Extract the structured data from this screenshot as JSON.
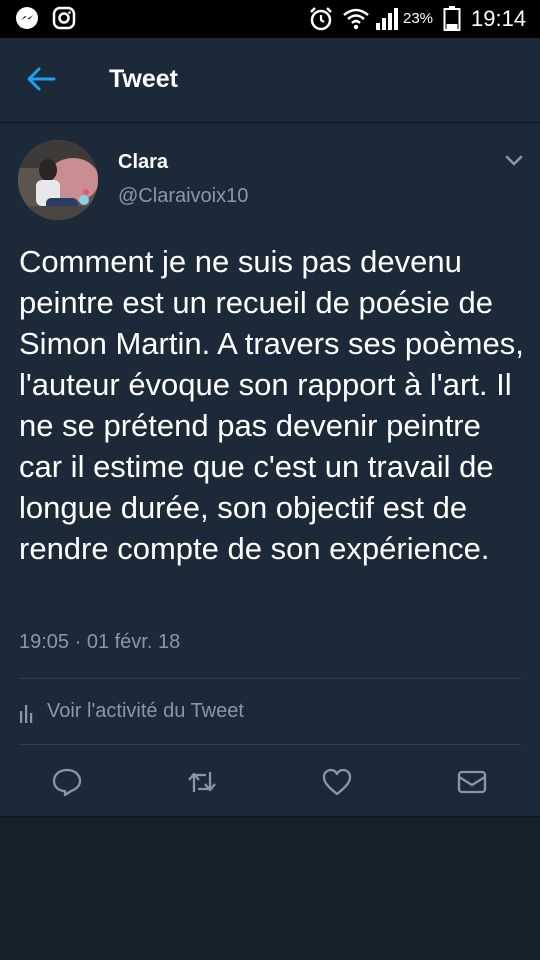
{
  "status_bar": {
    "battery_percent": "23%",
    "time": "19:14",
    "icons": [
      "messenger-icon",
      "instagram-icon",
      "alarm-icon",
      "wifi-icon",
      "signal-icon",
      "battery-icon"
    ]
  },
  "header": {
    "title": "Tweet",
    "back_icon": "back-arrow-icon"
  },
  "tweet": {
    "author_name": "Clara",
    "author_handle": "@Claraivoix10",
    "text": "Comment je ne suis pas devenu peintre est un recueil de poésie de Simon Martin. A travers ses poèmes, l'auteur évoque son rapport à l'art. Il ne se prétend pas devenir peintre car il estime que c'est un travail de longue durée, son objectif est de rendre compte de son expérience.",
    "timestamp": "19:05 · 01 févr. 18",
    "activity_label": "Voir l'activité du Tweet"
  },
  "actions": [
    "reply-icon",
    "retweet-icon",
    "like-icon",
    "direct-message-icon"
  ],
  "colors": {
    "background": "#15202b",
    "card": "#1c2938",
    "accent": "#1da1f2",
    "secondary_text": "#8899a6"
  }
}
